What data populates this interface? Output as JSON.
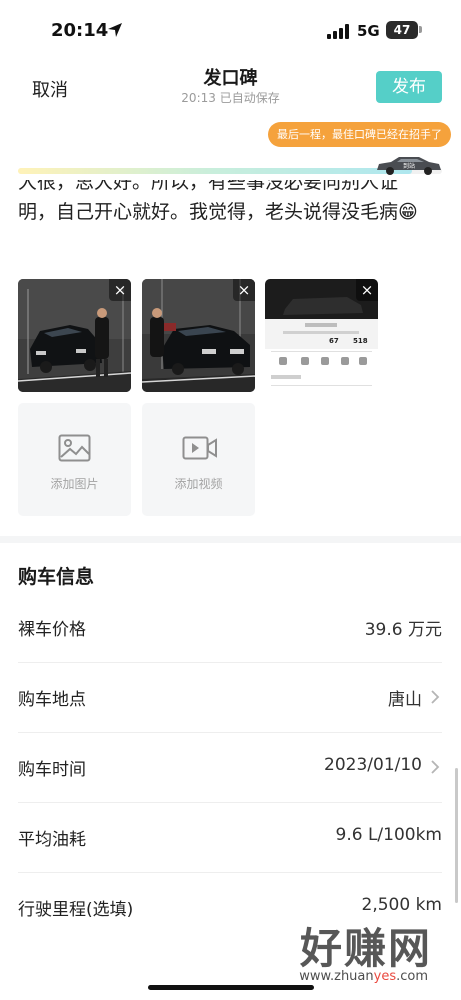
{
  "status_bar": {
    "time": "20:14",
    "network": "5G",
    "battery": "47",
    "icons": [
      "location-arrow-icon",
      "signal-icon",
      "battery-icon"
    ]
  },
  "header": {
    "cancel": "取消",
    "title": "发口碑",
    "autosave": "20:13 已自动保存",
    "publish": "发布"
  },
  "progress": {
    "tip": "最后一程，最佳口碑已经在招手了",
    "car_label": "到站",
    "fraction": 0.93
  },
  "body_text": {
    "line1": "大很，思大好。所以，有些事没必要向别人证",
    "line2": "明，自己开心就好。我觉得，老头说得没毛病😁"
  },
  "media": {
    "photos": [
      {
        "name": "photo-1",
        "remove": "×"
      },
      {
        "name": "photo-2",
        "remove": "×"
      },
      {
        "name": "photo-3",
        "remove": "×"
      }
    ],
    "screenshot_values": {
      "percent": "67",
      "range": "518"
    },
    "add_image": "添加图片",
    "add_video": "添加视频"
  },
  "purchase_info": {
    "title": "购车信息",
    "rows": [
      {
        "label": "裸车价格",
        "value": "39.6  万元",
        "arrow": false
      },
      {
        "label": "购车地点",
        "value": "唐山",
        "arrow": true
      },
      {
        "label": "购车时间",
        "value": "2023/01/10",
        "arrow": true
      },
      {
        "label": "平均油耗",
        "value": "9.6  L/100km",
        "arrow": false
      },
      {
        "label": "行驶里程(选填)",
        "value": "2,500  km",
        "arrow": false
      }
    ]
  },
  "watermark": {
    "big": "好赚网",
    "small_pre": "www.zhuan",
    "small_hl": "yes",
    "small_post": ".com"
  },
  "colors": {
    "accent": "#55cfc8",
    "tip": "#f5a23c"
  }
}
